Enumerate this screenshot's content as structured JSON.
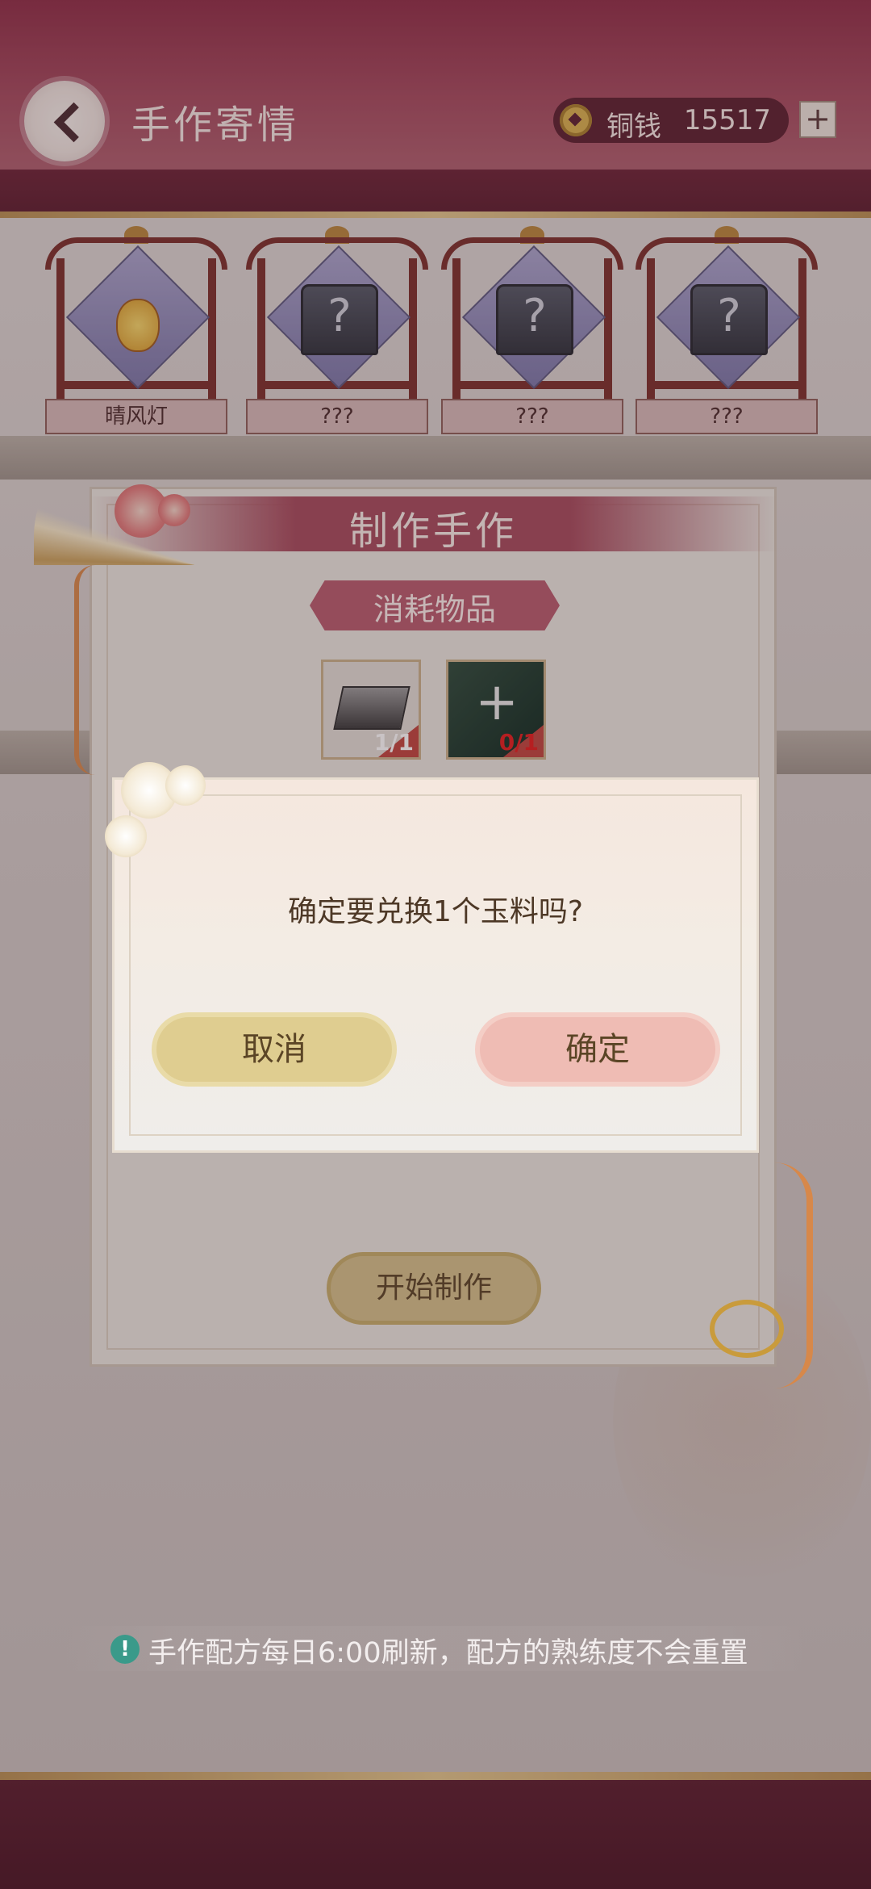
{
  "header": {
    "title": "手作寄情",
    "currency_label": "铜钱",
    "currency_value": "15517",
    "add_label": "+"
  },
  "recipes": [
    {
      "label": "晴风灯",
      "icon": "lantern-icon"
    },
    {
      "label": "???",
      "icon": "mystery-chest-icon"
    },
    {
      "label": "???",
      "icon": "mystery-chest-icon"
    },
    {
      "label": "???",
      "icon": "mystery-chest-icon"
    }
  ],
  "craft_panel": {
    "title": "制作手作",
    "consume_label": "消耗物品",
    "items": [
      {
        "name": "铁锭",
        "count": "1/1",
        "icon": "iron-ingot-icon"
      },
      {
        "name": "玉料",
        "count": "0/1",
        "icon": "jade-icon"
      }
    ],
    "start_button": "开始制作"
  },
  "dialog": {
    "message": "确定要兑换1个玉料吗?",
    "cancel_label": "取消",
    "confirm_label": "确定"
  },
  "tip": {
    "text": "手作配方每日6:00刷新，配方的熟练度不会重置",
    "icon": "info-icon"
  },
  "colors": {
    "header_bg": "#8e2d46",
    "accent": "#a64a5c",
    "confirm_button": "#efbcb4",
    "cancel_button": "#dfcd90"
  }
}
